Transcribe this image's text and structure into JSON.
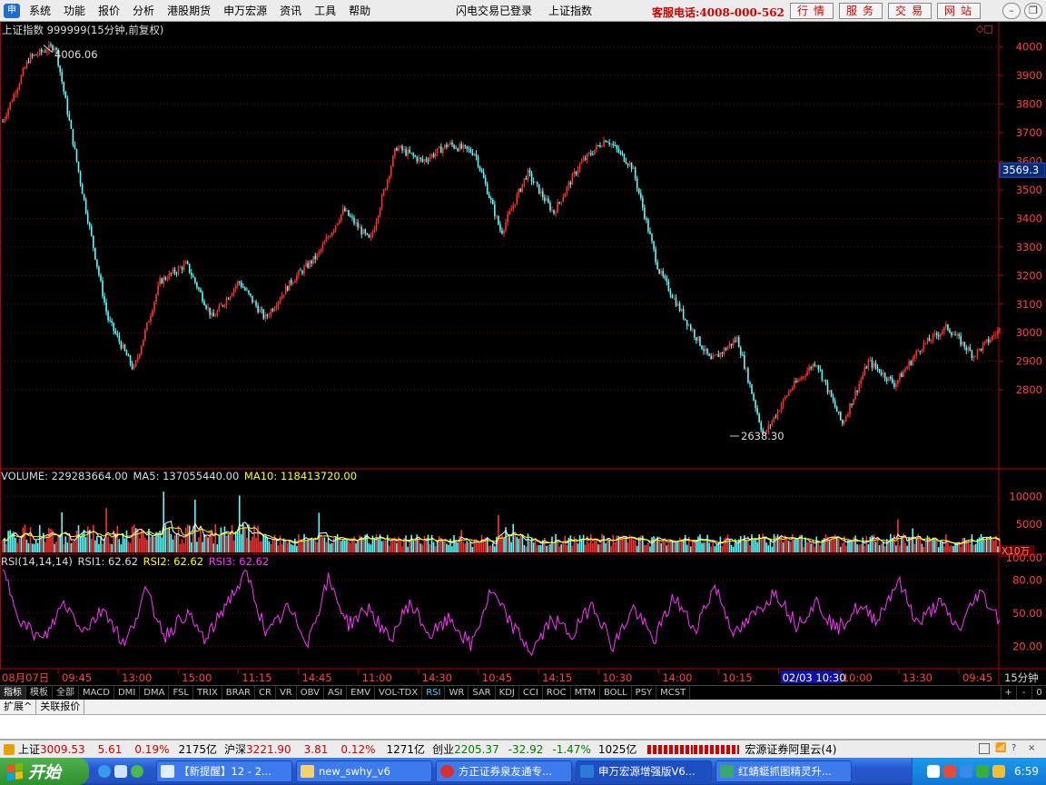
{
  "menu": {
    "items": [
      "系统",
      "功能",
      "报价",
      "分析",
      "港股期货",
      "申万宏源",
      "资讯",
      "工具",
      "帮助"
    ],
    "center": [
      "闪电交易已登录",
      "上证指数"
    ],
    "hotline": "客服电话:4008-000-562",
    "quick_buttons": [
      "行情",
      "服务",
      "交易",
      "网站"
    ]
  },
  "chart": {
    "title": "上证指数 999999(15分钟,前复权)",
    "high_label": "4006.06",
    "low_label": "2638.30",
    "current_price": "3569.3",
    "price_ticks": [
      "4000",
      "3900",
      "3800",
      "3700",
      "3600",
      "3500",
      "3400",
      "3300",
      "3200",
      "3100",
      "3000",
      "2900",
      "2800"
    ],
    "volume_header": {
      "volume": "VOLUME: 229283664.00",
      "ma5": "MA5: 137055440.00",
      "ma10": "MA10: 118413720.00"
    },
    "volume_ticks": [
      "10000",
      "5000"
    ],
    "volume_unit": "X10万",
    "rsi_header": {
      "name": "RSI(14,14,14)",
      "rsi1": "RSI1: 62.62",
      "rsi2": "RSI2: 62.62",
      "rsi3": "RSI3: 62.62"
    },
    "rsi_ticks": [
      "100.00",
      "80.00",
      "50.00",
      "20.00"
    ],
    "time_labels": [
      "08月07日",
      "09:45",
      "13:00",
      "15:00",
      "11:15",
      "14:45",
      "11:00",
      "14:30",
      "10:45",
      "14:15",
      "10:30",
      "14:00",
      "10:15",
      "02/03 10:30",
      "10:00",
      "13:30",
      "09:45"
    ],
    "period": "15分钟",
    "colors": {
      "up": "#ff3030",
      "down": "#54ffff",
      "ma5": "#ffffff",
      "ma10": "#ffff00",
      "rsi": "#ff33ff",
      "grid": "#7a0000",
      "axis_text": "#ff4040"
    }
  },
  "chart_data": {
    "type": "line",
    "title": "上证指数 999999(15分钟,前复权)",
    "series_name": "上证指数",
    "ylim": [
      2600,
      4050
    ],
    "keypoints": [
      {
        "label": "08月07日",
        "value": 3740
      },
      {
        "label": "",
        "value": 3960
      },
      {
        "label": "",
        "value": 4006.06
      },
      {
        "label": "",
        "value": 3510
      },
      {
        "label": "",
        "value": 3050
      },
      {
        "label": "",
        "value": 2870
      },
      {
        "label": "",
        "value": 3180
      },
      {
        "label": "",
        "value": 3240
      },
      {
        "label": "",
        "value": 3050
      },
      {
        "label": "",
        "value": 3180
      },
      {
        "label": "",
        "value": 3050
      },
      {
        "label": "",
        "value": 3180
      },
      {
        "label": "",
        "value": 3270
      },
      {
        "label": "",
        "value": 3430
      },
      {
        "label": "",
        "value": 3320
      },
      {
        "label": "",
        "value": 3650
      },
      {
        "label": "",
        "value": 3600
      },
      {
        "label": "",
        "value": 3660
      },
      {
        "label": "",
        "value": 3630
      },
      {
        "label": "",
        "value": 3350
      },
      {
        "label": "",
        "value": 3560
      },
      {
        "label": "",
        "value": 3420
      },
      {
        "label": "",
        "value": 3590
      },
      {
        "label": "",
        "value": 3680
      },
      {
        "label": "",
        "value": 3580
      },
      {
        "label": "",
        "value": 3220
      },
      {
        "label": "",
        "value": 3050
      },
      {
        "label": "",
        "value": 2900
      },
      {
        "label": "",
        "value": 2980
      },
      {
        "label": "",
        "value": 2638.3
      },
      {
        "label": "",
        "value": 2800
      },
      {
        "label": "",
        "value": 2900
      },
      {
        "label": "",
        "value": 2680
      },
      {
        "label": "",
        "value": 2900
      },
      {
        "label": "",
        "value": 2820
      },
      {
        "label": "",
        "value": 2950
      },
      {
        "label": "",
        "value": 3020
      },
      {
        "label": "",
        "value": 2920
      },
      {
        "label": "",
        "value": 3010
      }
    ],
    "volume_ylim": [
      0,
      12000
    ],
    "rsi_ylim": [
      0,
      100
    ],
    "rsi_keypoints": [
      88,
      40,
      25,
      60,
      35,
      55,
      20,
      70,
      30,
      50,
      25,
      60,
      85,
      30,
      55,
      25,
      80,
      40,
      55,
      25,
      60,
      30,
      45,
      20,
      70,
      40,
      15,
      45,
      30,
      60,
      20,
      55,
      25,
      65,
      35,
      75,
      30,
      50,
      70,
      40,
      60,
      35,
      55,
      45,
      80,
      40,
      60,
      35,
      70,
      45
    ]
  },
  "tabs": [
    "指标",
    "模板",
    "全部",
    "MACD",
    "DMI",
    "DMA",
    "FSL",
    "TRIX",
    "BRAR",
    "CR",
    "VR",
    "OBV",
    "ASI",
    "EMV",
    "VOL-TDX",
    "RSI",
    "WR",
    "SAR",
    "KDJ",
    "CCI",
    "ROC",
    "MTM",
    "BOLL",
    "PSY",
    "MCST"
  ],
  "tab_controls": [
    "+",
    "-",
    "0"
  ],
  "ext_tabs": [
    "扩展^",
    "关联报价"
  ],
  "status": {
    "sh_label": "上证",
    "sh_value": "3009.53",
    "sh_change": "5.61",
    "sh_pct": "0.19%",
    "sh_amount": "2175亿",
    "hs_label": "沪深",
    "hs_value": "3221.90",
    "hs_change": "3.81",
    "hs_pct": "0.12%",
    "hs_amount": "1271亿",
    "cy_label": "创业",
    "cy_value": "2205.37",
    "cy_change": "-32.92",
    "cy_pct": "-1.47%",
    "cy_amount": "1025亿",
    "server": "宏源证券阿里云(4)"
  },
  "taskbar": {
    "start": "开始",
    "tasks": [
      "【新提醒】12 - 2...",
      "new_swhy_v6",
      "方正证券泉友通专...",
      "申万宏源增强版V6...",
      "红蜻蜓抓图精灵升..."
    ],
    "clock": "6:59"
  }
}
